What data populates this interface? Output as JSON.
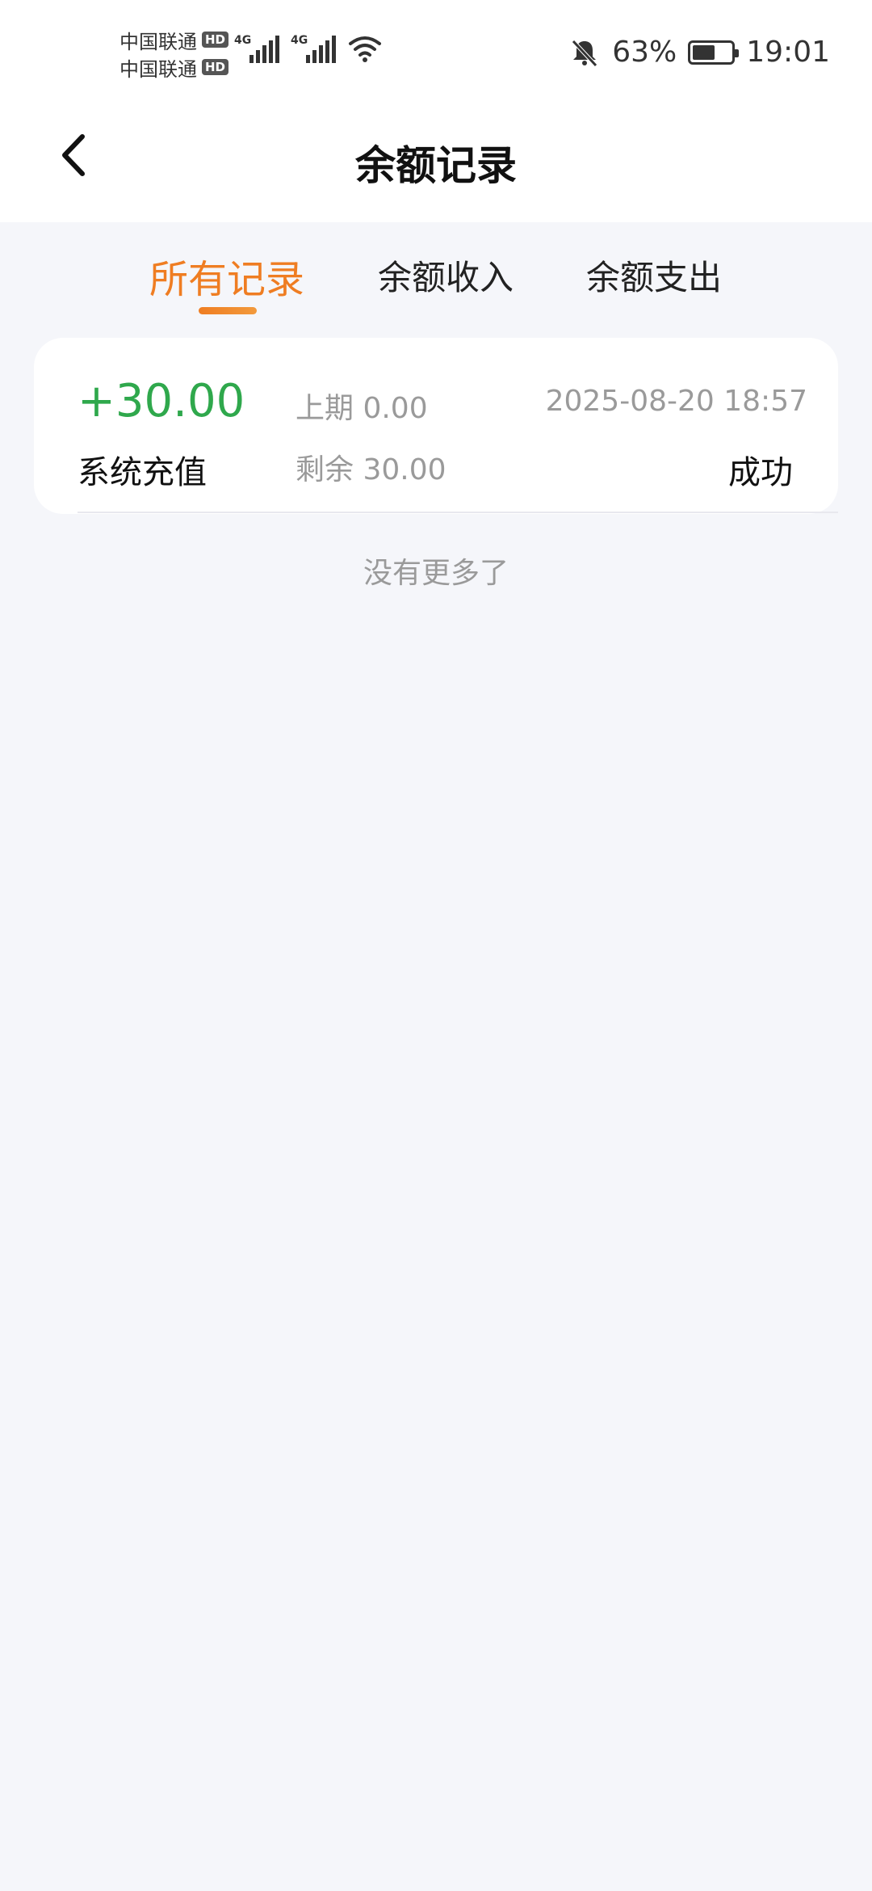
{
  "status_bar": {
    "carriers": [
      {
        "name": "中国联通",
        "badge": "HD"
      },
      {
        "name": "中国联通",
        "badge": "HD"
      }
    ],
    "network_labels": [
      "4G",
      "4G"
    ],
    "battery_percent_text": "63%",
    "battery_level": 0.63,
    "time": "19:01",
    "icons": [
      "signal-icon",
      "wifi-icon",
      "mute-bell-icon",
      "battery-icon"
    ]
  },
  "header": {
    "title": "余额记录",
    "back_icon": "back-chevron-icon"
  },
  "tabs": [
    {
      "label": "所有记录",
      "active": true
    },
    {
      "label": "余额收入",
      "active": false
    },
    {
      "label": "余额支出",
      "active": false
    }
  ],
  "colors": {
    "accent": "#ef7d22",
    "income": "#2fa84c",
    "muted": "#9a9a9a",
    "background": "#f5f6fa"
  },
  "records": [
    {
      "amount": "+30.00",
      "type": "系统充值",
      "previous": "上期 0.00",
      "remaining": "剩余 30.00",
      "time": "2025-08-20 18:57",
      "status": "成功"
    }
  ],
  "footer_text": "没有更多了"
}
